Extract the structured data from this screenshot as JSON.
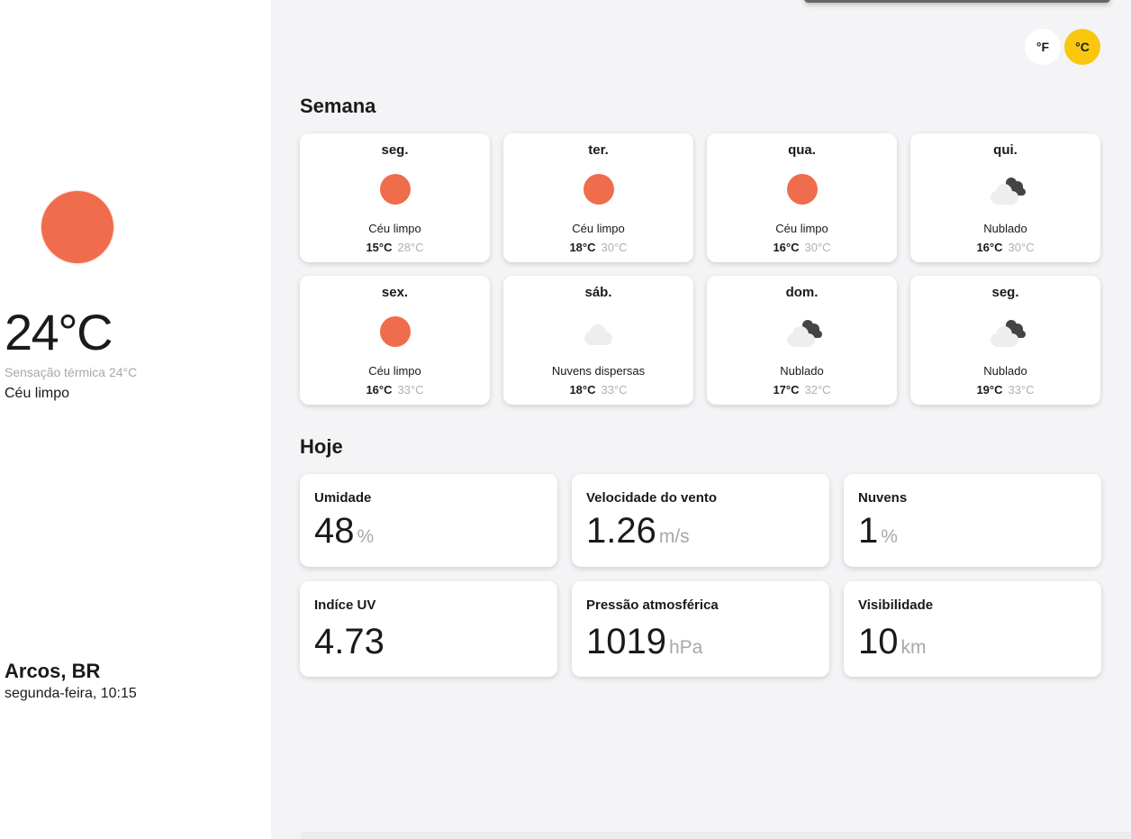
{
  "current": {
    "temperature": "24°C",
    "feels_like": "Sensação térmica 24°C",
    "condition": "Céu limpo",
    "icon": "sun-icon",
    "location": "Arcos, BR",
    "datetime": "segunda-feira, 10:15"
  },
  "units": {
    "fahrenheit_label": "°F",
    "celsius_label": "°C",
    "selected": "celsius"
  },
  "week": {
    "title": "Semana",
    "days": [
      {
        "name": "seg.",
        "icon": "sun-icon",
        "desc": "Céu limpo",
        "min": "15°C",
        "max": "28°C"
      },
      {
        "name": "ter.",
        "icon": "sun-icon",
        "desc": "Céu limpo",
        "min": "18°C",
        "max": "30°C"
      },
      {
        "name": "qua.",
        "icon": "sun-icon",
        "desc": "Céu limpo",
        "min": "16°C",
        "max": "30°C"
      },
      {
        "name": "qui.",
        "icon": "broken-clouds-icon",
        "desc": "Nublado",
        "min": "16°C",
        "max": "30°C"
      },
      {
        "name": "sex.",
        "icon": "sun-icon",
        "desc": "Céu limpo",
        "min": "16°C",
        "max": "33°C"
      },
      {
        "name": "sáb.",
        "icon": "scattered-clouds-icon",
        "desc": "Nuvens dispersas",
        "min": "18°C",
        "max": "33°C"
      },
      {
        "name": "dom.",
        "icon": "broken-clouds-icon",
        "desc": "Nublado",
        "min": "17°C",
        "max": "32°C"
      },
      {
        "name": "seg.",
        "icon": "broken-clouds-icon",
        "desc": "Nublado",
        "min": "19°C",
        "max": "33°C"
      }
    ]
  },
  "today": {
    "title": "Hoje",
    "stats": [
      {
        "label": "Umidade",
        "value": "48",
        "unit": "%"
      },
      {
        "label": "Velocidade do vento",
        "value": "1.26",
        "unit": "m/s"
      },
      {
        "label": "Nuvens",
        "value": "1",
        "unit": "%"
      },
      {
        "label": "Indíce UV",
        "value": "4.73",
        "unit": ""
      },
      {
        "label": "Pressão atmosférica",
        "value": "1019",
        "unit": "hPa"
      },
      {
        "label": "Visibilidade",
        "value": "10",
        "unit": "km"
      }
    ]
  },
  "colors": {
    "sun": "#ef6d4c",
    "accent": "#f9c80e",
    "background": "#f4f4f6",
    "muted_text": "#a8a8a8"
  }
}
